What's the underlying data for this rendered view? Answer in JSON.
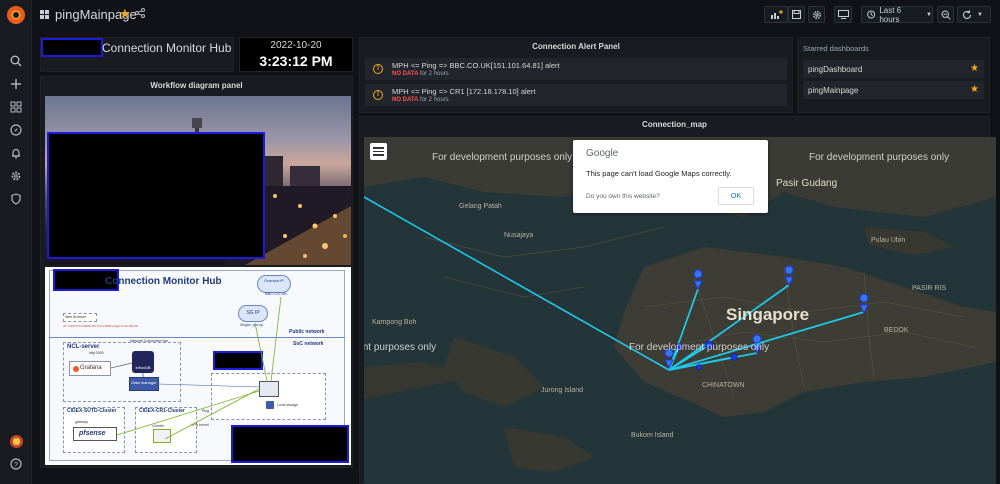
{
  "dashboard": {
    "title": "pingMainpage"
  },
  "toolbar": {
    "time_range": "Last 6 hours"
  },
  "hub_panel": {
    "title": "Connection Monitor Hub"
  },
  "clock": {
    "date": "2022-10-20",
    "time": "3:23:12 PM"
  },
  "alert_panel": {
    "title": "Connection Alert Panel",
    "alerts": [
      {
        "name": "MPH <= Ping => BBC.CO.UK[151.101.64.81] alert",
        "state": "NO DATA",
        "since": "for 2 hours"
      },
      {
        "name": "MPH <= Ping => CR1 [172.18.178.10] alert",
        "state": "NO DATA",
        "since": "for 2 hours"
      }
    ]
  },
  "starred": {
    "title": "Starred dashboards",
    "items": [
      "pingDashboard",
      "pingMainpage"
    ]
  },
  "workflow": {
    "title": "Workflow diagram panel",
    "diagram_title": "Connection Monitor Hub",
    "labels": {
      "overseas_ip": "Oversea IP",
      "bbc": "BBC.CO.UK",
      "sg_ip": "SG IP",
      "sg_ip_sub": "Singtel, gov.sg",
      "public_network": "Public network",
      "soc_network": "SoC network",
      "ncl_server": "NCL-server",
      "http": "http:3000",
      "ncl_hub": "Network Connection hub",
      "grafana": "Grafana",
      "influx": "InfluxDB",
      "data_manager": "Data manager",
      "local_storage": "Local storage",
      "web_browser": "Web Browser",
      "web_url": "url: 4.227.0.0.3:3000,127.0.0.1:3000 ps@172.29.181.99",
      "cidex_suto": "CIDEX-SUTD-Cluster",
      "cidex_cr1": "CIDEX-CR1-Cluster",
      "gateway": "gateway",
      "pfsense": "pfsense",
      "vcenter": "vCenter",
      "vpn": "VPN tunnel",
      "ping": "Ping"
    }
  },
  "map_panel": {
    "title": "Connection_map",
    "watermark": "For development purposes only",
    "dialog": {
      "brand": "Google",
      "message": "This page can't load Google Maps correctly.",
      "link": "Do you own this website?",
      "ok": "OK"
    },
    "places": {
      "singapore": "Singapore",
      "pasir_gudang": "Pasir Gudang",
      "nusajaya": "Nusajaya",
      "gelang_patah": "Gelang Patah",
      "kampong_bohd": "Kampong Boh",
      "pulau_ubin": "Pulau Ubin",
      "jurong_island": "Jurong Island",
      "bukom": "Bukom Island",
      "chinatown": "CHINATOWN",
      "pasir_ris": "PASIR RIS",
      "bedok": "BEDOK"
    }
  }
}
